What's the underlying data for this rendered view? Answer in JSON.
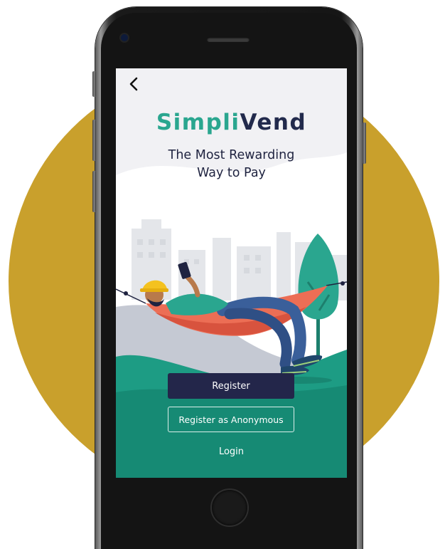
{
  "app": {
    "brand_part1": "Simpli",
    "brand_part2": "Vend",
    "tagline_line1": "The Most Rewarding",
    "tagline_line2": "Way to Pay"
  },
  "actions": {
    "register_label": "Register",
    "register_anonymous_label": "Register as Anonymous",
    "login_label": "Login"
  },
  "icons": {
    "back": "chevron-left-icon",
    "illustration": "hammock-illustration"
  },
  "colors": {
    "brand_teal": "#2aa68f",
    "brand_navy": "#222a4c",
    "button_navy": "#23264a",
    "background_gold": "#c9a02c",
    "hill_green": "#1d9c84"
  }
}
